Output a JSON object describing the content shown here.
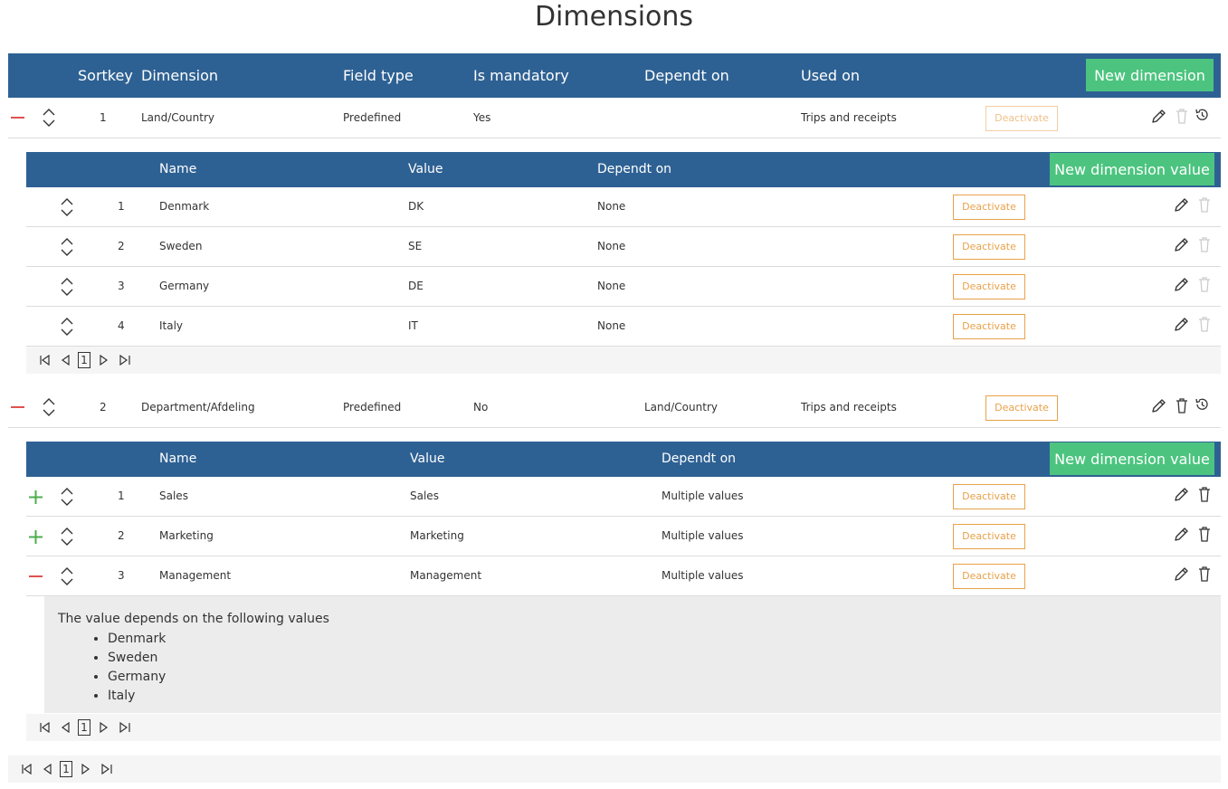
{
  "page": {
    "title": "Dimensions"
  },
  "colors": {
    "header_bg": "#2e6193",
    "accent_green": "#4cc47f",
    "deactivate": "#e8a14a",
    "remove_red": "#e0524f",
    "add_green": "#4cae4c"
  },
  "main_table": {
    "headers": {
      "sortkey": "Sortkey",
      "dimension": "Dimension",
      "field_type": "Field type",
      "is_mandatory": "Is mandatory",
      "dependt_on": "Dependt on",
      "used_on": "Used on"
    },
    "new_button": "New dimension",
    "rows": [
      {
        "sortkey": "1",
        "dimension": "Land/Country",
        "field_type": "Predefined",
        "is_mandatory": "Yes",
        "dependt_on": "",
        "used_on": "Trips and receipts",
        "deactivate": "Deactivate",
        "expanded": true
      },
      {
        "sortkey": "2",
        "dimension": "Department/Afdeling",
        "field_type": "Predefined",
        "is_mandatory": "No",
        "dependt_on": "Land/Country",
        "used_on": "Trips and receipts",
        "deactivate": "Deactivate",
        "expanded": true
      }
    ],
    "pager": {
      "page": "1"
    }
  },
  "sub_table_1": {
    "headers": {
      "name": "Name",
      "value": "Value",
      "dependt_on": "Dependt on"
    },
    "new_button": "New dimension value",
    "rows": [
      {
        "sortkey": "1",
        "name": "Denmark",
        "value": "DK",
        "dependt_on": "None",
        "deactivate": "Deactivate"
      },
      {
        "sortkey": "2",
        "name": "Sweden",
        "value": "SE",
        "dependt_on": "None",
        "deactivate": "Deactivate"
      },
      {
        "sortkey": "3",
        "name": "Germany",
        "value": "DE",
        "dependt_on": "None",
        "deactivate": "Deactivate"
      },
      {
        "sortkey": "4",
        "name": "Italy",
        "value": "IT",
        "dependt_on": "None",
        "deactivate": "Deactivate"
      }
    ],
    "pager": {
      "page": "1"
    }
  },
  "sub_table_2": {
    "headers": {
      "name": "Name",
      "value": "Value",
      "dependt_on": "Dependt on"
    },
    "new_button": "New dimension value",
    "rows": [
      {
        "sortkey": "1",
        "name": "Sales",
        "value": "Sales",
        "dependt_on": "Multiple values",
        "deactivate": "Deactivate"
      },
      {
        "sortkey": "2",
        "name": "Marketing",
        "value": "Marketing",
        "dependt_on": "Multiple values",
        "deactivate": "Deactivate"
      },
      {
        "sortkey": "3",
        "name": "Management",
        "value": "Management",
        "dependt_on": "Multiple values",
        "deactivate": "Deactivate"
      }
    ],
    "dependency": {
      "title": "The value depends on the following values",
      "items": [
        "Denmark",
        "Sweden",
        "Germany",
        "Italy"
      ]
    },
    "pager": {
      "page": "1"
    }
  }
}
